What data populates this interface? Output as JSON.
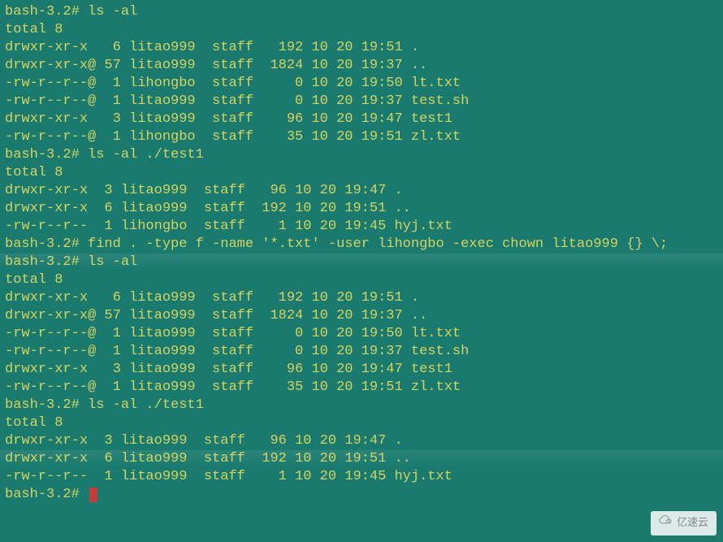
{
  "prompt": "bash-3.2#",
  "watermark_text": "亿速云",
  "session": [
    {
      "type": "cmd",
      "text": "bash-3.2# ls -al"
    },
    {
      "type": "out",
      "text": "total 8"
    },
    {
      "type": "out",
      "text": "drwxr-xr-x   6 litao999  staff   192 10 20 19:51 ."
    },
    {
      "type": "out",
      "text": "drwxr-xr-x@ 57 litao999  staff  1824 10 20 19:37 .."
    },
    {
      "type": "out",
      "text": "-rw-r--r--@  1 lihongbo  staff     0 10 20 19:50 lt.txt"
    },
    {
      "type": "out",
      "text": "-rw-r--r--@  1 litao999  staff     0 10 20 19:37 test.sh"
    },
    {
      "type": "out",
      "text": "drwxr-xr-x   3 litao999  staff    96 10 20 19:47 test1"
    },
    {
      "type": "out",
      "text": "-rw-r--r--@  1 lihongbo  staff    35 10 20 19:51 zl.txt"
    },
    {
      "type": "cmd",
      "text": "bash-3.2# ls -al ./test1"
    },
    {
      "type": "out",
      "text": "total 8"
    },
    {
      "type": "out",
      "text": "drwxr-xr-x  3 litao999  staff   96 10 20 19:47 ."
    },
    {
      "type": "out",
      "text": "drwxr-xr-x  6 litao999  staff  192 10 20 19:51 .."
    },
    {
      "type": "out",
      "text": "-rw-r--r--  1 lihongbo  staff    1 10 20 19:45 hyj.txt"
    },
    {
      "type": "cmd",
      "text": "bash-3.2# find . -type f -name '*.txt' -user lihongbo -exec chown litao999 {} \\;"
    },
    {
      "type": "out",
      "text": ""
    },
    {
      "type": "cmd",
      "text": "bash-3.2# ls -al"
    },
    {
      "type": "out",
      "text": "total 8"
    },
    {
      "type": "out",
      "text": "drwxr-xr-x   6 litao999  staff   192 10 20 19:51 ."
    },
    {
      "type": "out",
      "text": "drwxr-xr-x@ 57 litao999  staff  1824 10 20 19:37 .."
    },
    {
      "type": "out",
      "text": "-rw-r--r--@  1 litao999  staff     0 10 20 19:50 lt.txt"
    },
    {
      "type": "out",
      "text": "-rw-r--r--@  1 litao999  staff     0 10 20 19:37 test.sh"
    },
    {
      "type": "out",
      "text": "drwxr-xr-x   3 litao999  staff    96 10 20 19:47 test1"
    },
    {
      "type": "out",
      "text": "-rw-r--r--@  1 litao999  staff    35 10 20 19:51 zl.txt"
    },
    {
      "type": "cmd",
      "text": "bash-3.2# ls -al ./test1"
    },
    {
      "type": "out",
      "text": "total 8"
    },
    {
      "type": "out",
      "text": "drwxr-xr-x  3 litao999  staff   96 10 20 19:47 ."
    },
    {
      "type": "out",
      "text": "drwxr-xr-x  6 litao999  staff  192 10 20 19:51 .."
    },
    {
      "type": "out",
      "text": "-rw-r--r--  1 litao999  staff    1 10 20 19:45 hyj.txt"
    }
  ],
  "final_prompt": "bash-3.2# "
}
